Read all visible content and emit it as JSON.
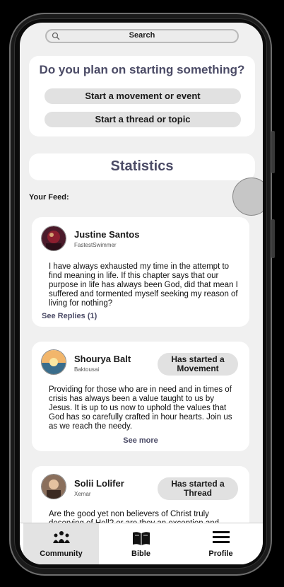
{
  "search": {
    "label": "Search"
  },
  "plan": {
    "title": "Do you plan on starting something?",
    "buttons": [
      "Start a movement or event",
      "Start a thread or topic"
    ]
  },
  "statistics": {
    "title": "Statistics"
  },
  "feed": {
    "label": "Your Feed:",
    "posts": [
      {
        "name": "Justine Santos",
        "handle": "FastestSwimmer",
        "body": "I have always exhausted my time in the attempt to find meaning in life. If this chapter says that our purpose in life has always been God, did that mean I suffered and tormented myself seeking my reason of living for nothing?",
        "action": "See Replies (1)"
      },
      {
        "name": "Shourya Balt",
        "handle": "Baktousai",
        "badge": "Has started a Movement",
        "body": "Providing for those who are in need and in times of crisis has always been a value taught to us by Jesus. It is up to us now to uphold the values that God has so carefully crafted in hour hearts. Join us as we reach the needy.",
        "action": "See more"
      },
      {
        "name": "Solii Lolifer",
        "handle": "Xemar",
        "badge": "Has started a Thread",
        "body": "Are the good yet non believers of Christ truly deserving of Hell? or are they an exception and"
      }
    ]
  },
  "nav": {
    "items": [
      {
        "label": "Community",
        "icon": "community-icon",
        "active": true
      },
      {
        "label": "Bible",
        "icon": "bible-icon",
        "active": false
      },
      {
        "label": "Profile",
        "icon": "menu-icon",
        "active": false
      }
    ]
  },
  "colors": {
    "accent": "#4b4b66",
    "pill": "#e1e1e1",
    "screen_bg": "#f0f0f0"
  }
}
